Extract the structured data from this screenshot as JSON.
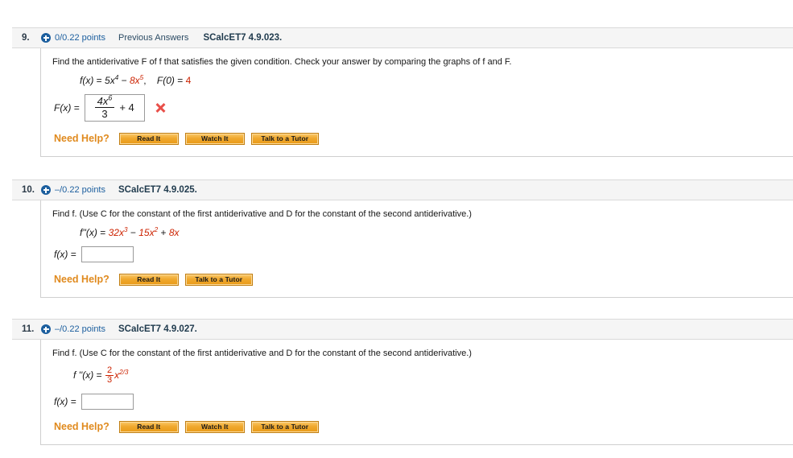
{
  "problems": [
    {
      "number": "9.",
      "points": "0/0.22 points",
      "previous_answers": "Previous Answers",
      "book_ref": "SCalcET7 4.9.023.",
      "prompt": "Find the antiderivative F of f that satisfies the given condition. Check your answer by comparing the graphs of f and F.",
      "equation": {
        "lhs": "f(x)",
        "eq": "=",
        "term1": "5x",
        "term1_exp": "4",
        "minus": "−",
        "term2": "8x",
        "term2_exp": "5",
        "comma": ",",
        "cond_lhs": "F(0)",
        "cond_eq": "=",
        "cond_val": "4"
      },
      "answer_label": "F(x) =",
      "answer_value": {
        "numerator": "4x",
        "numerator_exp": "6",
        "denominator": "3",
        "trailing": "+ 4"
      },
      "answer_status": "incorrect",
      "status_icon": "x-mark-icon",
      "need_help_label": "Need Help?",
      "help_buttons": [
        "Read It",
        "Watch It",
        "Talk to a Tutor"
      ]
    },
    {
      "number": "10.",
      "points": "–/0.22 points",
      "previous_answers": "",
      "book_ref": "SCalcET7 4.9.025.",
      "prompt": "Find f. (Use C for the constant of the first antiderivative and D for the constant of the second antiderivative.)",
      "equation": {
        "lhs": "f''(x)",
        "eq": "=",
        "term1": "32x",
        "term1_exp": "3",
        "minus": "−",
        "term2": "15x",
        "term2_exp": "2",
        "plus": "+",
        "term3": "8x"
      },
      "answer_label": "f(x) =",
      "answer_input_value": "",
      "answer_input_placeholder": "",
      "need_help_label": "Need Help?",
      "help_buttons": [
        "Read It",
        "Talk to a Tutor"
      ]
    },
    {
      "number": "11.",
      "points": "–/0.22 points",
      "previous_answers": "",
      "book_ref": "SCalcET7 4.9.027.",
      "prompt": "Find f. (Use C for the constant of the first antiderivative and D for the constant of the second antiderivative.)",
      "equation": {
        "lhs": "f ''(x)",
        "eq": "=",
        "frac_num": "2",
        "frac_den": "3",
        "var": "x",
        "var_exp": "2/3"
      },
      "answer_label": "f(x) =",
      "answer_input_value": "",
      "answer_input_placeholder": "",
      "need_help_label": "Need Help?",
      "help_buttons": [
        "Read It",
        "Watch It",
        "Talk to a Tutor"
      ]
    }
  ],
  "colors": {
    "accent_blue": "#1b5e9e",
    "red_math": "#cc2200",
    "orange_button": "#f0a82e",
    "need_help_orange": "#e08a1e",
    "header_bg": "#f5f5f5",
    "x_mark_red": "#e8504a"
  }
}
